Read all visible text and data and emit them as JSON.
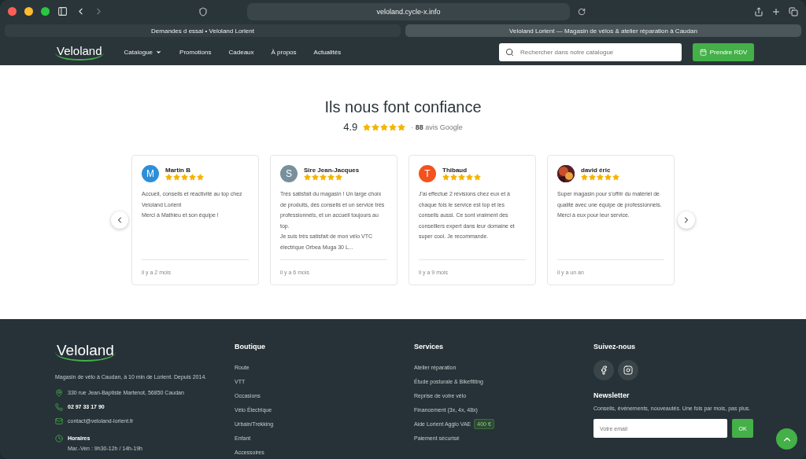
{
  "browser": {
    "address": "veloland.cycle-x.info",
    "tabs": [
      {
        "label": "Demandes d essai • Veloland Lorient",
        "selected": false
      },
      {
        "label": "Veloland Lorient — Magasin de vélos & atelier réparation à Caudan",
        "selected": true
      }
    ]
  },
  "nav": {
    "logo": "Veloland",
    "items": [
      {
        "label": "Catalogue",
        "dropdown": true
      },
      {
        "label": "Promotions",
        "dropdown": false
      },
      {
        "label": "Cadeaux",
        "dropdown": false
      },
      {
        "label": "À propos",
        "dropdown": false
      },
      {
        "label": "Actualités",
        "dropdown": false
      }
    ],
    "search": {
      "placeholder": "Rechercher dans notre catalogue"
    },
    "cta": "Prendre RDV"
  },
  "reviews": {
    "title": "Ils nous font confiance",
    "rating": "4.9",
    "stars": 5,
    "separator": "·",
    "count": "88",
    "count_label": "avis Google",
    "items": [
      {
        "name": "Martin B",
        "avatar": {
          "kind": "letter",
          "letter": "M",
          "color": "#2e8fd8"
        },
        "stars": 5,
        "text": [
          "Accueil, conseils et réactivité au top chez Veloland Lorient",
          "Merci à Mathieu et son équipe !"
        ],
        "time": "il y a 2 mois"
      },
      {
        "name": "Sire Jean-Jacques",
        "avatar": {
          "kind": "letter",
          "letter": "S",
          "color": "#78909c"
        },
        "stars": 5,
        "text": [
          "Très satisfait du magasin ! Un large choix de produits, des conseils et un service très professionnels, et un accueil toujours au top.",
          "Je suis très satisfait de mon vélo VTC électrique Orbea Muga 30 L..."
        ],
        "time": "il y a 6 mois"
      },
      {
        "name": "Thibaud",
        "avatar": {
          "kind": "letter",
          "letter": "T",
          "color": "#f4511e"
        },
        "stars": 5,
        "text": [
          "J'ai effectué 2 révisions chez eux et à chaque fois le service est top et les conseils aussi. Ce sont vraiment des conseillers expert dans leur domaine et super cool. Je recommande."
        ],
        "time": "il y a 9 mois"
      },
      {
        "name": "david éric",
        "avatar": {
          "kind": "picture"
        },
        "stars": 5,
        "text": [
          "Super magasin pour s'offrir du matériel de qualité avec une équipe de professionnels. Merci à eux pour leur service."
        ],
        "time": "il y a un an"
      }
    ]
  },
  "footer": {
    "logo": "Veloland",
    "tagline": "Magasin de vélo à Caudan, à 10 min de Lorient. Depuis 2014.",
    "contacts": [
      {
        "kind": "address",
        "text": "330 rue Jean-Baptiste Martenot, 56850 Caudan"
      },
      {
        "kind": "phone",
        "text": "02 97 33 17 90"
      },
      {
        "kind": "email",
        "text": "contact@veloland-lorient.fr"
      },
      {
        "kind": "hours",
        "text": "Horaires",
        "detail": "Mar.-Ven : 9h30-12h / 14h-19h"
      }
    ],
    "columns": [
      {
        "title": "Boutique",
        "links": [
          {
            "label": "Route"
          },
          {
            "label": "VTT"
          },
          {
            "label": "Occasions"
          },
          {
            "label": "Vélo Électrique"
          },
          {
            "label": "Urbain/Trekking"
          },
          {
            "label": "Enfant"
          },
          {
            "label": "Accessoires"
          }
        ]
      },
      {
        "title": "Services",
        "links": [
          {
            "label": "Atelier réparation"
          },
          {
            "label": "Étude posturale & Bikefitting"
          },
          {
            "label": "Reprise de votre vélo"
          },
          {
            "label": "Financement (3x, 4x, 48x)"
          },
          {
            "label": "Aide Lorient Agglo VAE",
            "badge": "400 €"
          },
          {
            "label": "Paiement sécurisé"
          }
        ]
      }
    ],
    "social": {
      "title": "Suivez-nous",
      "networks": [
        {
          "kind": "facebook"
        },
        {
          "kind": "instagram"
        }
      ]
    },
    "newsletter": {
      "title": "Newsletter",
      "text": "Conseils, événements, nouveautés. Une fois par mois, pas plus.",
      "placeholder": "Votre email",
      "button": "OK"
    }
  }
}
